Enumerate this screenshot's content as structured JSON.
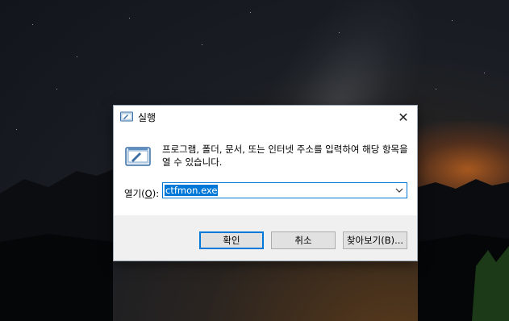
{
  "dialog": {
    "title": "실행",
    "close_glyph": "✕",
    "description": "프로그램, 폴더, 문서, 또는 인터넷 주소를 입력하여 해당 항목을 열 수 있습니다.",
    "open_label_prefix": "열기(",
    "open_label_accel": "O",
    "open_label_suffix": "):",
    "command_value": "ctfmon.exe",
    "buttons": {
      "ok": "확인",
      "cancel": "취소",
      "browse": "찾아보기(B)..."
    }
  },
  "colors": {
    "accent": "#0078d7",
    "footer_bg": "#f0f0f0",
    "button_bg": "#e1e1e1"
  },
  "icons": {
    "title": "run-icon",
    "large": "run-icon",
    "close": "close-icon",
    "dropdown": "chevron-down-icon"
  }
}
